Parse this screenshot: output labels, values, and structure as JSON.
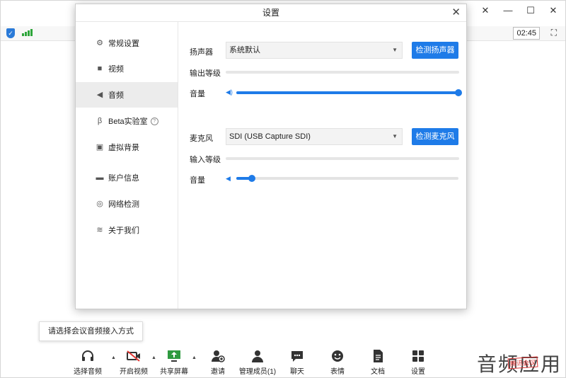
{
  "window": {
    "controls": [
      "✕",
      "—",
      "☐",
      "✕"
    ],
    "time": "02:45"
  },
  "dialog": {
    "title": "设置",
    "close": "✕",
    "sidebar": [
      {
        "label": "常规设置",
        "icon": "gear-icon",
        "glyph": "⚙"
      },
      {
        "label": "视频",
        "icon": "video-camera-icon",
        "glyph": "■"
      },
      {
        "label": "音频",
        "icon": "speaker-icon",
        "glyph": "◀"
      },
      {
        "label": "Beta实验室",
        "icon": "beta-icon",
        "glyph": "β"
      },
      {
        "label": "虚拟背景",
        "icon": "virtual-background-icon",
        "glyph": "▣"
      },
      {
        "label": "账户信息",
        "icon": "account-card-icon",
        "glyph": "▬"
      },
      {
        "label": "网络检测",
        "icon": "globe-icon",
        "glyph": "◎"
      },
      {
        "label": "关于我们",
        "icon": "about-logo-icon",
        "glyph": "≋"
      }
    ],
    "help_glyph": "?",
    "audio": {
      "speaker_label": "扬声器",
      "speaker_device": "系统默认",
      "speaker_test_button": "检测扬声器",
      "output_level_label": "输出等级",
      "output_volume_label": "音量",
      "output_volume_percent": 100,
      "mic_label": "麦克风",
      "mic_device": "SDI (USB Capture SDI)",
      "mic_test_button": "检测麦克风",
      "input_level_label": "输入等级",
      "input_volume_label": "音量",
      "input_volume_percent": 7
    }
  },
  "tooltip": "请选择会议音频接入方式",
  "toolbar": [
    {
      "label": "选择音频",
      "icon": "headset-icon"
    },
    {
      "label": "开启视频",
      "icon": "video-off-icon"
    },
    {
      "label": "共享屏幕",
      "icon": "share-screen-icon"
    },
    {
      "label": "邀请",
      "icon": "invite-icon"
    },
    {
      "label": "管理成员(1)",
      "icon": "members-icon"
    },
    {
      "label": "聊天",
      "icon": "chat-icon"
    },
    {
      "label": "表情",
      "icon": "emoji-icon"
    },
    {
      "label": "文档",
      "icon": "document-icon"
    },
    {
      "label": "设置",
      "icon": "settings-grid-icon"
    }
  ],
  "watermark": {
    "text": "音频应用",
    "stamp": "腾讯会议"
  },
  "colors": {
    "accent": "#1e7be8",
    "active_bg": "#ececec"
  }
}
